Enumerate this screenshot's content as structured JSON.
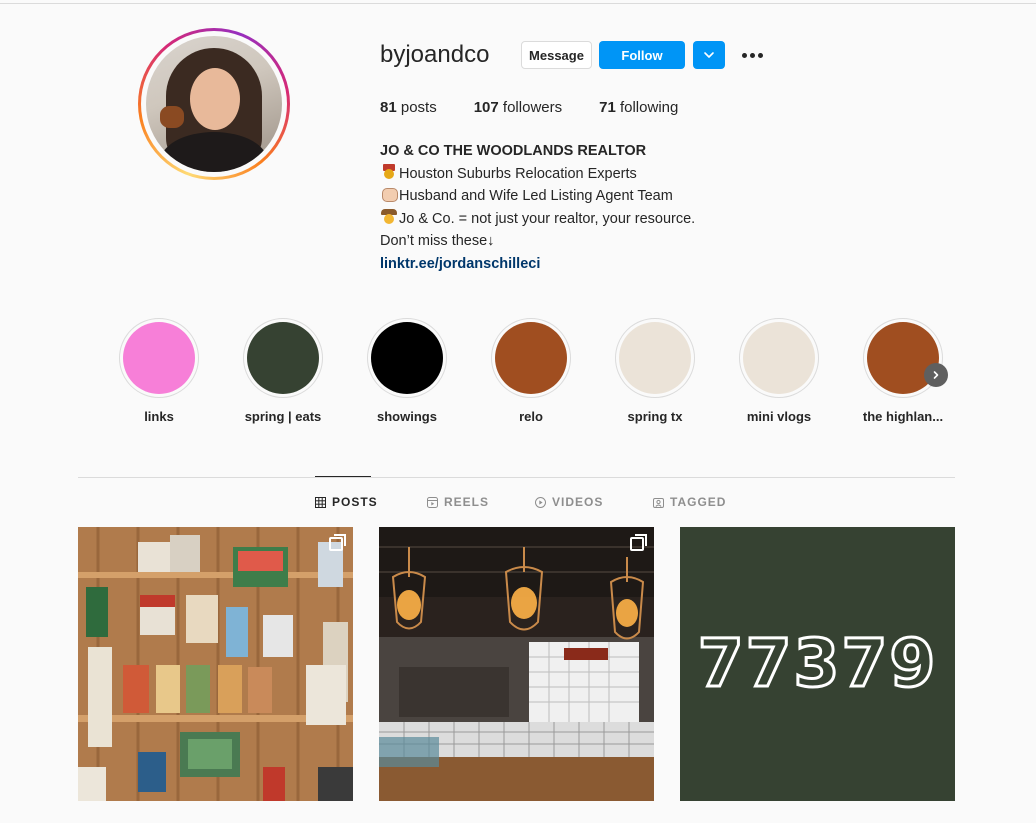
{
  "profile": {
    "username": "byjoandco",
    "buttons": {
      "message": "Message",
      "follow": "Follow"
    },
    "stats": [
      {
        "count": "81",
        "label": "posts"
      },
      {
        "count": "107",
        "label": "followers"
      },
      {
        "count": "71",
        "label": "following"
      }
    ],
    "bio": {
      "name": "JO & CO THE WOODLANDS REALTOR",
      "lines": [
        {
          "emoji": "medal-icon",
          "text": "Houston Suburbs Relocation Experts"
        },
        {
          "emoji": "fist-bump-icon",
          "text": "Husband and Wife Led Listing Agent Team"
        },
        {
          "emoji": "cowboy-icon",
          "text": "Jo & Co. = not just your realtor, your resource."
        },
        {
          "emoji": "",
          "text": "Don’t miss these↓"
        }
      ],
      "link": "linktr.ee/jordanschilleci"
    }
  },
  "highlights": [
    {
      "label": "links",
      "color": "#f77fd8"
    },
    {
      "label": "spring | eats",
      "color": "#364232"
    },
    {
      "label": "showings",
      "color": "#000000"
    },
    {
      "label": "relo",
      "color": "#a04e20"
    },
    {
      "label": "spring tx",
      "color": "#ebe3d8"
    },
    {
      "label": "mini vlogs",
      "color": "#ebe3d8"
    },
    {
      "label": "the highlan...",
      "color": "#a04e20"
    }
  ],
  "tabs": [
    {
      "label": "POSTS",
      "icon": "grid-icon",
      "active": true
    },
    {
      "label": "REELS",
      "icon": "reels-icon",
      "active": false
    },
    {
      "label": "VIDEOS",
      "icon": "play-icon",
      "active": false
    },
    {
      "label": "TAGGED",
      "icon": "tag-icon",
      "active": false
    }
  ],
  "posts": [
    {
      "type": "carousel",
      "description_icon": "multiple-images-icon"
    },
    {
      "type": "carousel",
      "description_icon": "multiple-images-icon"
    },
    {
      "type": "image",
      "text": "77379"
    }
  ],
  "colors": {
    "accent": "#0095f6",
    "link": "#00376b",
    "text": "#262626",
    "muted": "#8e8e8e"
  }
}
